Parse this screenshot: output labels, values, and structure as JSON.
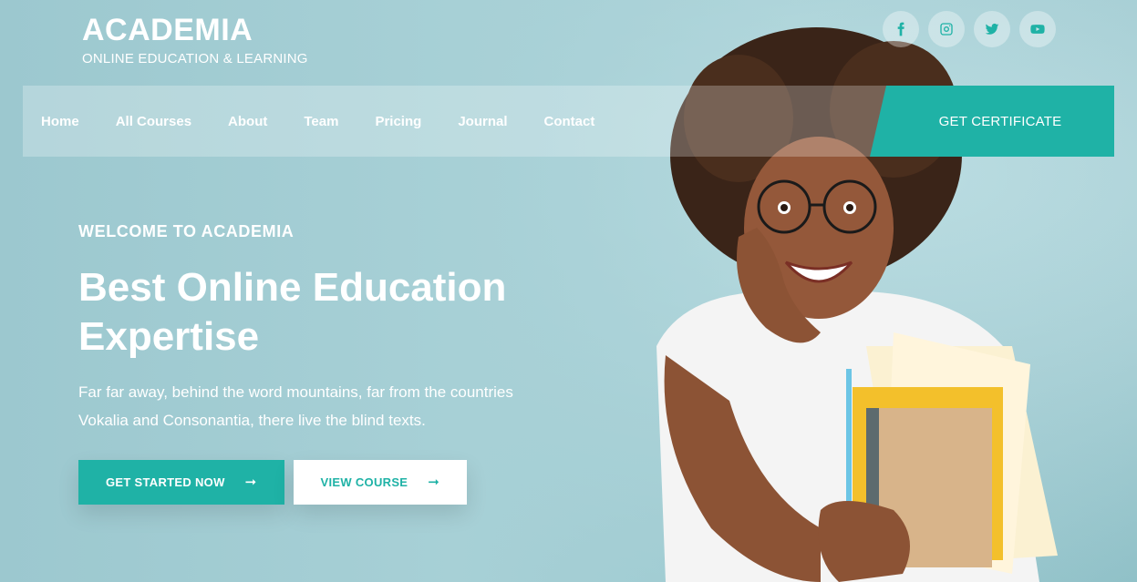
{
  "brand": {
    "name": "ACADEMIA",
    "tagline": "ONLINE EDUCATION & LEARNING"
  },
  "social": [
    {
      "icon": "facebook-icon"
    },
    {
      "icon": "instagram-icon"
    },
    {
      "icon": "twitter-icon"
    },
    {
      "icon": "youtube-icon"
    }
  ],
  "nav": {
    "items": [
      "Home",
      "All Courses",
      "About",
      "Team",
      "Pricing",
      "Journal",
      "Contact"
    ],
    "cta": "GET CERTIFICATE"
  },
  "hero": {
    "eyebrow": "WELCOME TO ACADEMIA",
    "headline_line1": "Best Online Education",
    "headline_line2": "Expertise",
    "lead_line1": "Far far away, behind the word mountains, far from the countries",
    "lead_line2": "Vokalia and Consonantia, there live the blind texts.",
    "primary_button": "GET STARTED NOW",
    "secondary_button": "VIEW COURSE",
    "arrow": "➞"
  },
  "colors": {
    "accent": "#1fb2a6",
    "background": "#a9d0d6",
    "text": "#ffffff"
  }
}
